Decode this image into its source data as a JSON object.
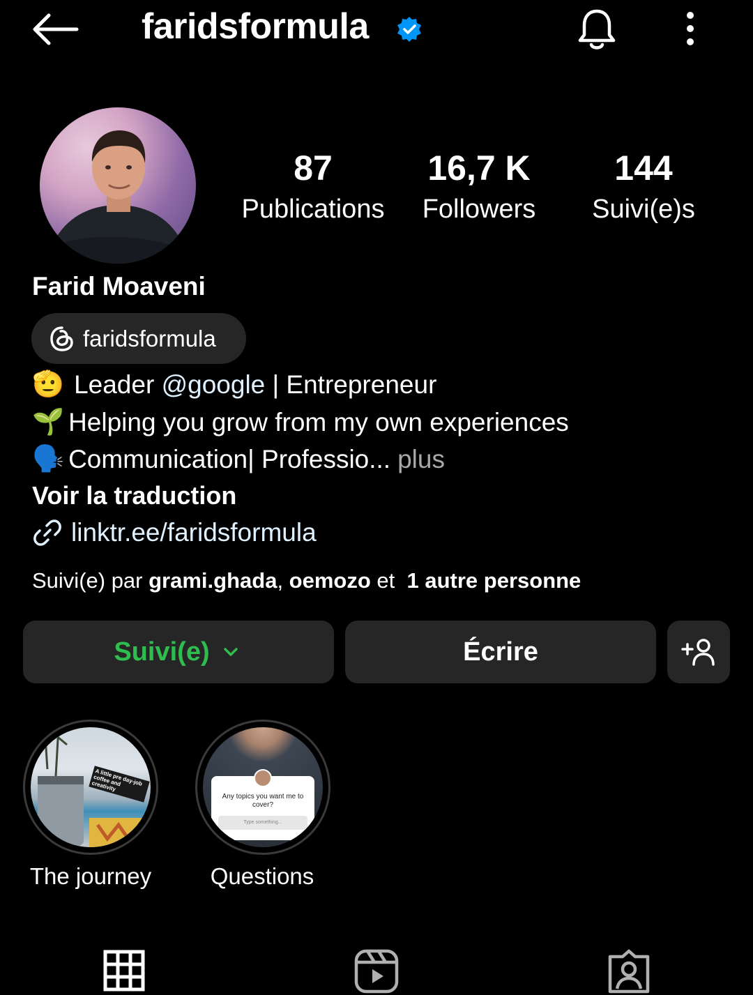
{
  "header": {
    "username": "faridsformula",
    "verified": true,
    "icons": [
      "back-arrow-icon",
      "verified-badge-icon",
      "bell-icon",
      "more-vertical-icon"
    ]
  },
  "profile": {
    "display_name": "Farid Moaveni",
    "stats": {
      "posts_value": "87",
      "posts_label": "Publications",
      "followers_value": "16,7 K",
      "followers_label": "Followers",
      "following_value": "144",
      "following_label": "Suivi(e)s"
    },
    "threads_handle": "faridsformula",
    "bio": {
      "line1_emoji": "🫡",
      "line1_text_a": "Leader ",
      "line1_mention": "@google",
      "line1_text_b": " | Entrepreneur",
      "line2_emoji": "🌱",
      "line2_text": "Helping you grow from my own experiences",
      "line3_emoji": "🗣️",
      "line3_text": "Communication| Professio...",
      "more_label": "plus"
    },
    "translate_label": "Voir la traduction",
    "link": "linktr.ee/faridsformula",
    "followed_by": {
      "prefix": "Suivi(e) par ",
      "user1": "grami.ghada",
      "sep": ", ",
      "user2": "oemozo",
      "and": " et  ",
      "others": "1 autre personne"
    }
  },
  "actions": {
    "follow_label": "Suivi(e)",
    "message_label": "Écrire"
  },
  "highlights": [
    {
      "label": "The journey",
      "sticker_text": "A little pre day-job coffee and creativity"
    },
    {
      "label": "Questions",
      "question": "Any topics you want me to cover?",
      "placeholder": "Type something..."
    }
  ],
  "colors": {
    "background": "#000000",
    "surface": "#262626",
    "accent_green": "#2ebd4e",
    "verified_blue": "#0095f6",
    "link": "#e0f1ff"
  }
}
